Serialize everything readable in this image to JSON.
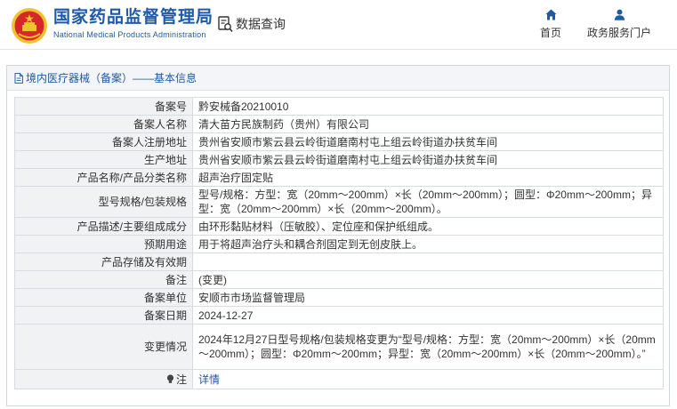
{
  "header": {
    "brand_cn": "国家药品监督管理局",
    "brand_en": "National Medical Products Administration",
    "query_label": "数据查询",
    "nav": [
      {
        "label": "首页",
        "icon": "home-icon"
      },
      {
        "label": "政务服务门户",
        "icon": "user-icon"
      }
    ]
  },
  "panel": {
    "title": "境内医疗器械（备案）——基本信息"
  },
  "rows": [
    {
      "key": "备案号",
      "value": "黔安械备20210010"
    },
    {
      "key": "备案人名称",
      "value": "清大苗方民族制药（贵州）有限公司"
    },
    {
      "key": "备案人注册地址",
      "value": "贵州省安顺市紫云县云岭街道磨南村屯上组云岭街道办扶贫车间"
    },
    {
      "key": "生产地址",
      "value": "贵州省安顺市紫云县云岭街道磨南村屯上组云岭街道办扶贫车间"
    },
    {
      "key": "产品名称/产品分类名称",
      "value": "超声治疗固定贴"
    },
    {
      "key": "型号规格/包装规格",
      "value": "型号/规格：方型：宽（20mm～200mm）×长（20mm～200mm）；圆型：Φ20mm～200mm；异型：宽（20mm～200mm）×长（20mm～200mm）。"
    },
    {
      "key": "产品描述/主要组成成分",
      "value": "由环形黏贴材料（压敏胶）、定位座和保护纸组成。"
    },
    {
      "key": "预期用途",
      "value": "用于将超声治疗头和耦合剂固定到无创皮肤上。"
    },
    {
      "key": "产品存储及有效期",
      "value": ""
    },
    {
      "key": "备注",
      "value": "(变更)"
    },
    {
      "key": "备案单位",
      "value": "安顺市市场监督管理局"
    },
    {
      "key": "备案日期",
      "value": "2024-12-27"
    },
    {
      "key": "变更情况",
      "value": "2024年12月27日型号规格/包装规格变更为“型号/规格：方型：宽（20mm～200mm）×长（20mm～200mm）；圆型：Φ20mm～200mm；异型：宽（20mm～200mm）×长（20mm～200mm）。”"
    },
    {
      "key": "注",
      "value": "详情"
    }
  ],
  "colors": {
    "brand": "#1f5aa8",
    "key_bg": "#f1f2f4",
    "logo_red": "#d62828",
    "logo_gold": "#f2c12e"
  }
}
